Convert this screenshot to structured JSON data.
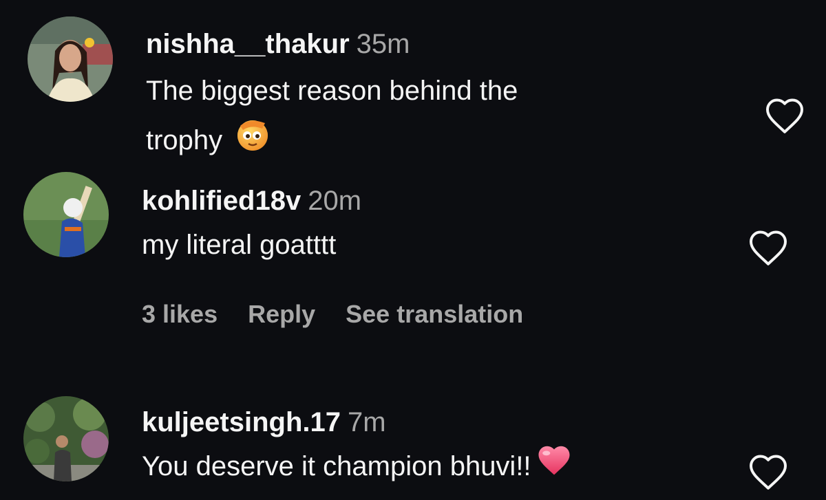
{
  "comments": [
    {
      "username": "nishha__thakur",
      "time": "35m",
      "line1": "The biggest reason behind the",
      "line2": "trophy"
    },
    {
      "username": "kohlified18v",
      "time": "20m",
      "text": "my literal goatttt",
      "likes": "3 likes",
      "reply": "Reply",
      "translate": "See translation"
    },
    {
      "username": "kuljeetsingh.17",
      "time": "7m",
      "text": "You deserve it champion bhuvi!!"
    }
  ],
  "icons": {
    "like": "heart-outline-icon",
    "emoji_salute": "saluting-face-icon",
    "emoji_heart": "pink-heart-icon"
  },
  "colors": {
    "background": "#0c0d11",
    "text": "#f5f5f5",
    "secondary": "#a8a8a8"
  }
}
